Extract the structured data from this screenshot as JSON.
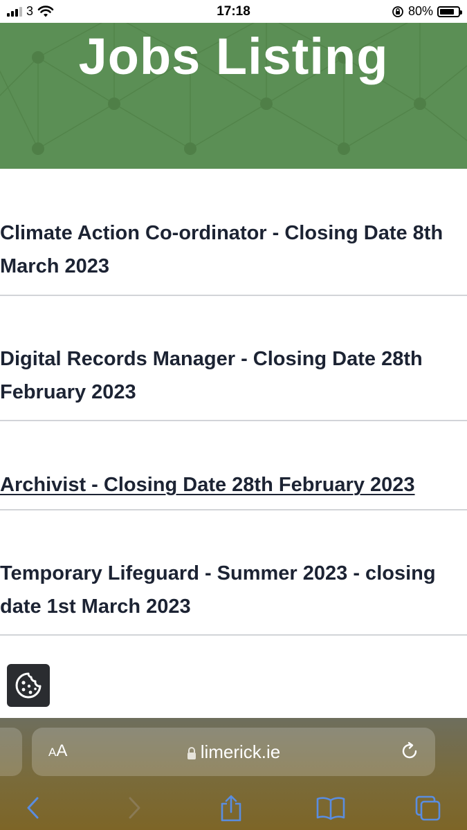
{
  "status_bar": {
    "carrier": "3",
    "time": "17:18",
    "battery_percent": "80%",
    "battery_level": 0.8
  },
  "banner": {
    "title": "Jobs Listing",
    "background_color": "#5b8f55"
  },
  "jobs": [
    {
      "title": "Climate Action Co-ordinator - Closing Date 8th March 2023"
    },
    {
      "title": "Digital Records Manager - Closing Date 28th February 2023"
    },
    {
      "title": "Archivist - Closing Date 28th February 2023"
    },
    {
      "title": "Temporary Lifeguard - Summer 2023 - closing date 1st March 2023"
    }
  ],
  "cookie_button": {
    "icon": "cookie-icon"
  },
  "browser": {
    "text_size_label_small": "A",
    "text_size_label_large": "A",
    "url": "limerick.ie",
    "icons": [
      "lock-icon",
      "reload-icon",
      "back-icon",
      "forward-icon",
      "share-icon",
      "bookmarks-icon",
      "tabs-icon"
    ]
  }
}
